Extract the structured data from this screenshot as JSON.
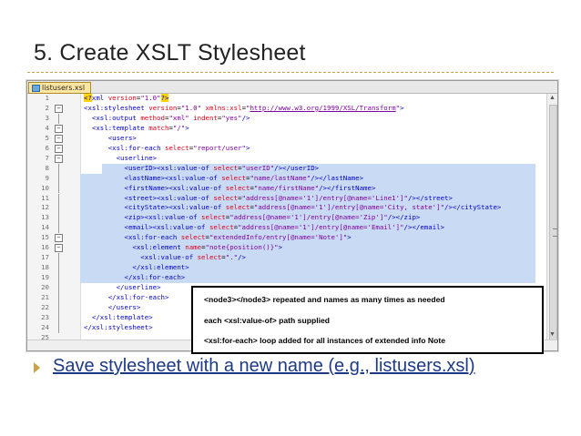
{
  "slide": {
    "title": "5. Create XSLT Stylesheet",
    "bullet": "Save stylesheet with a new name (e.g., listusers.xsl)"
  },
  "editor": {
    "tab_label": "listusers.xsl",
    "lines": [
      {
        "n": "1",
        "fold": "none",
        "segs": [
          {
            "t": "pi",
            "v": "<?"
          },
          {
            "t": "tag",
            "v": "xml "
          },
          {
            "t": "attr",
            "v": "version"
          },
          {
            "t": "plain",
            "v": "="
          },
          {
            "t": "val",
            "v": "\"1.0\""
          },
          {
            "t": "pi",
            "v": "?>"
          }
        ]
      },
      {
        "n": "2",
        "fold": "open",
        "segs": [
          {
            "t": "tag",
            "v": "<xsl:stylesheet "
          },
          {
            "t": "attr",
            "v": "version"
          },
          {
            "t": "plain",
            "v": "="
          },
          {
            "t": "val",
            "v": "\"1.0\" "
          },
          {
            "t": "attr",
            "v": "xmlns:xsl"
          },
          {
            "t": "plain",
            "v": "="
          },
          {
            "t": "val",
            "v": "\""
          },
          {
            "t": "url",
            "v": "http://www.w3.org/1999/XSL/Transform"
          },
          {
            "t": "val",
            "v": "\""
          },
          {
            "t": "tag",
            "v": ">"
          }
        ]
      },
      {
        "n": "3",
        "fold": "line",
        "segs": [
          {
            "t": "plain",
            "v": "  "
          },
          {
            "t": "tag",
            "v": "<xsl:output "
          },
          {
            "t": "attr",
            "v": "method"
          },
          {
            "t": "plain",
            "v": "="
          },
          {
            "t": "val",
            "v": "\"xml\" "
          },
          {
            "t": "attr",
            "v": "indent"
          },
          {
            "t": "plain",
            "v": "="
          },
          {
            "t": "val",
            "v": "\"yes\""
          },
          {
            "t": "tag",
            "v": "/>"
          }
        ]
      },
      {
        "n": "4",
        "fold": "open",
        "segs": [
          {
            "t": "plain",
            "v": "  "
          },
          {
            "t": "tag",
            "v": "<xsl:template "
          },
          {
            "t": "attr",
            "v": "match"
          },
          {
            "t": "plain",
            "v": "="
          },
          {
            "t": "val",
            "v": "\"/\""
          },
          {
            "t": "tag",
            "v": ">"
          }
        ]
      },
      {
        "n": "5",
        "fold": "open",
        "segs": [
          {
            "t": "plain",
            "v": "      "
          },
          {
            "t": "tag",
            "v": "<users>"
          }
        ]
      },
      {
        "n": "6",
        "fold": "open",
        "segs": [
          {
            "t": "plain",
            "v": "      "
          },
          {
            "t": "tag",
            "v": "<xsl:for-each "
          },
          {
            "t": "attr",
            "v": "select"
          },
          {
            "t": "plain",
            "v": "="
          },
          {
            "t": "val",
            "v": "\"report/user\""
          },
          {
            "t": "tag",
            "v": ">"
          }
        ]
      },
      {
        "n": "7",
        "fold": "open",
        "segs": [
          {
            "t": "plain",
            "v": "        "
          },
          {
            "t": "tag",
            "v": "<userline>"
          }
        ]
      },
      {
        "n": "8",
        "fold": "line",
        "segs": [
          {
            "t": "plain",
            "v": "          "
          },
          {
            "t": "tag",
            "v": "<userID><xsl:value-of "
          },
          {
            "t": "attr",
            "v": "select"
          },
          {
            "t": "plain",
            "v": "="
          },
          {
            "t": "val",
            "v": "\"userID\""
          },
          {
            "t": "tag",
            "v": "/></userID>"
          }
        ]
      },
      {
        "n": "9",
        "fold": "line",
        "segs": [
          {
            "t": "plain",
            "v": "          "
          },
          {
            "t": "tag",
            "v": "<lastName><xsl:value-of "
          },
          {
            "t": "attr",
            "v": "select"
          },
          {
            "t": "plain",
            "v": "="
          },
          {
            "t": "val",
            "v": "\"name/lastName\""
          },
          {
            "t": "tag",
            "v": "/></lastName>"
          }
        ]
      },
      {
        "n": "10",
        "fold": "line",
        "segs": [
          {
            "t": "plain",
            "v": "          "
          },
          {
            "t": "tag",
            "v": "<firstName><xsl:value-of "
          },
          {
            "t": "attr",
            "v": "select"
          },
          {
            "t": "plain",
            "v": "="
          },
          {
            "t": "val",
            "v": "\"name/firstName\""
          },
          {
            "t": "tag",
            "v": "/></firstName>"
          }
        ]
      },
      {
        "n": "11",
        "fold": "line",
        "segs": [
          {
            "t": "plain",
            "v": "          "
          },
          {
            "t": "tag",
            "v": "<street><xsl:value-of "
          },
          {
            "t": "attr",
            "v": "select"
          },
          {
            "t": "plain",
            "v": "="
          },
          {
            "t": "val",
            "v": "\"address[@name='1']/entry[@name='Line1']\""
          },
          {
            "t": "tag",
            "v": "/></street>"
          }
        ]
      },
      {
        "n": "12",
        "fold": "line",
        "segs": [
          {
            "t": "plain",
            "v": "          "
          },
          {
            "t": "tag",
            "v": "<cityState><xsl:value-of "
          },
          {
            "t": "attr",
            "v": "select"
          },
          {
            "t": "plain",
            "v": "="
          },
          {
            "t": "val",
            "v": "\"address[@name='1']/entry[@name='City, state']\""
          },
          {
            "t": "tag",
            "v": "/></cityState>"
          }
        ]
      },
      {
        "n": "13",
        "fold": "line",
        "segs": [
          {
            "t": "plain",
            "v": "          "
          },
          {
            "t": "tag",
            "v": "<zip><xsl:value-of "
          },
          {
            "t": "attr",
            "v": "select"
          },
          {
            "t": "plain",
            "v": "="
          },
          {
            "t": "val",
            "v": "\"address[@name='1']/entry[@name='Zip']\""
          },
          {
            "t": "tag",
            "v": "/></zip>"
          }
        ]
      },
      {
        "n": "14",
        "fold": "line",
        "segs": [
          {
            "t": "plain",
            "v": "          "
          },
          {
            "t": "tag",
            "v": "<email><xsl:value-of "
          },
          {
            "t": "attr",
            "v": "select"
          },
          {
            "t": "plain",
            "v": "="
          },
          {
            "t": "val",
            "v": "\"address[@name='1']/entry[@name='Email']\""
          },
          {
            "t": "tag",
            "v": "/></email>"
          }
        ]
      },
      {
        "n": "15",
        "fold": "open",
        "segs": [
          {
            "t": "plain",
            "v": "          "
          },
          {
            "t": "tag",
            "v": "<xsl:for-each "
          },
          {
            "t": "attr",
            "v": "select"
          },
          {
            "t": "plain",
            "v": "="
          },
          {
            "t": "val",
            "v": "\"extendedInfo/entry[@name='Note']\""
          },
          {
            "t": "tag",
            "v": ">"
          }
        ]
      },
      {
        "n": "16",
        "fold": "open",
        "segs": [
          {
            "t": "plain",
            "v": "            "
          },
          {
            "t": "tag",
            "v": "<xsl:element "
          },
          {
            "t": "attr",
            "v": "name"
          },
          {
            "t": "plain",
            "v": "="
          },
          {
            "t": "val",
            "v": "\"note{position()}\""
          },
          {
            "t": "tag",
            "v": ">"
          }
        ]
      },
      {
        "n": "17",
        "fold": "line",
        "segs": [
          {
            "t": "plain",
            "v": "              "
          },
          {
            "t": "tag",
            "v": "<xsl:value-of "
          },
          {
            "t": "attr",
            "v": "select"
          },
          {
            "t": "plain",
            "v": "="
          },
          {
            "t": "val",
            "v": "\".\""
          },
          {
            "t": "tag",
            "v": "/>"
          }
        ]
      },
      {
        "n": "18",
        "fold": "end",
        "segs": [
          {
            "t": "plain",
            "v": "            "
          },
          {
            "t": "tag",
            "v": "</xsl:element>"
          }
        ]
      },
      {
        "n": "19",
        "fold": "end",
        "segs": [
          {
            "t": "plain",
            "v": "          "
          },
          {
            "t": "tag",
            "v": "</xsl:for-each>"
          }
        ]
      },
      {
        "n": "20",
        "fold": "end",
        "segs": [
          {
            "t": "plain",
            "v": "        "
          },
          {
            "t": "tag",
            "v": "</userline>"
          }
        ]
      },
      {
        "n": "21",
        "fold": "end",
        "segs": [
          {
            "t": "plain",
            "v": "      "
          },
          {
            "t": "tag",
            "v": "</xsl:for-each>"
          }
        ]
      },
      {
        "n": "22",
        "fold": "end",
        "segs": [
          {
            "t": "plain",
            "v": "      "
          },
          {
            "t": "tag",
            "v": "</users>"
          }
        ]
      },
      {
        "n": "23",
        "fold": "end",
        "segs": [
          {
            "t": "plain",
            "v": "  "
          },
          {
            "t": "tag",
            "v": "</xsl:template>"
          }
        ]
      },
      {
        "n": "24",
        "fold": "end",
        "segs": [
          {
            "t": "tag",
            "v": "</xsl:stylesheet>"
          }
        ]
      },
      {
        "n": "25",
        "fold": "none",
        "segs": []
      }
    ]
  },
  "callout": {
    "line1": "<node3></node3> repeated and names as many times as needed",
    "line2": "each <xsl:value-of> path supplied",
    "line3": "<xsl:for-each> loop added for all instances of extended info Note"
  }
}
